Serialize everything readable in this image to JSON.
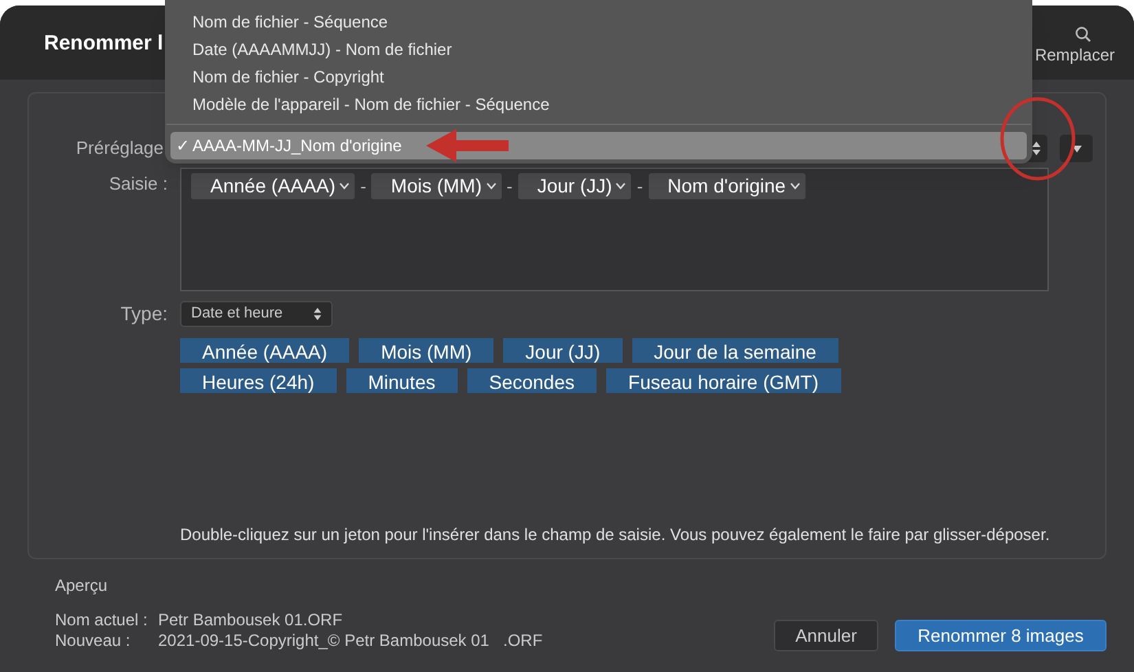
{
  "window": {
    "title": "Renommer l"
  },
  "header": {
    "search_label": "Remplacer"
  },
  "preset": {
    "label": "Préréglage",
    "menu": [
      {
        "label": "Nom de fichier - Séquence",
        "selected": false
      },
      {
        "label": "Date (AAAAMMJJ) - Nom de fichier",
        "selected": false
      },
      {
        "label": "Nom de fichier - Copyright",
        "selected": false
      },
      {
        "label": "Modèle de l'appareil - Nom de fichier - Séquence",
        "selected": false
      },
      {
        "label": "AAAA-MM-JJ_Nom d'origine",
        "selected": true
      }
    ],
    "check": "✓"
  },
  "entry": {
    "label": "Saisie :",
    "tokens": [
      {
        "label": "Année (AAAA)",
        "separator": "-"
      },
      {
        "label": "Mois (MM)",
        "separator": "-"
      },
      {
        "label": "Jour (JJ)",
        "separator": "-"
      },
      {
        "label": "Nom d'origine"
      }
    ]
  },
  "type": {
    "label": "Type:",
    "value": "Date et heure"
  },
  "token_rows": [
    [
      "Année (AAAA)",
      "Mois (MM)",
      "Jour (JJ)",
      "Jour de la semaine"
    ],
    [
      "Heures (24h)",
      "Minutes",
      "Secondes",
      "Fuseau horaire (GMT)"
    ]
  ],
  "hint": "Double-cliquez sur un jeton pour l'insérer dans le champ de saisie. Vous pouvez également le faire par glisser-déposer.",
  "preview": {
    "title": "Aperçu",
    "rows": [
      {
        "label": "Nom actuel :",
        "value": "Petr Bambousek 01.ORF"
      },
      {
        "label": "Nouveau :",
        "value": "2021-09-15-Copyright_© Petr Bambousek 01   .ORF"
      }
    ]
  },
  "buttons": [
    {
      "label": "Annuler",
      "kind": "secondary"
    },
    {
      "label": "Renommer 8 images",
      "kind": "primary"
    }
  ]
}
